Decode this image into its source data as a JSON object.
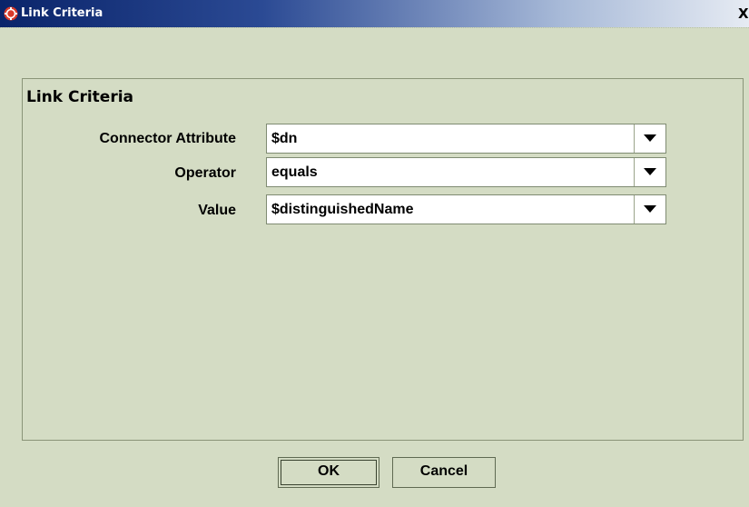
{
  "window": {
    "title": "Link Criteria",
    "close_label": "X",
    "icon": "app-logo-icon"
  },
  "panel": {
    "title": "Link Criteria",
    "fields": [
      {
        "label": "Connector Attribute",
        "value": "$dn",
        "icon": "chevron-down-icon"
      },
      {
        "label": "Operator",
        "value": "equals",
        "icon": "chevron-down-icon"
      },
      {
        "label": "Value",
        "value": "$distinguishedName",
        "icon": "chevron-down-icon"
      }
    ]
  },
  "buttons": {
    "ok_label": "OK",
    "cancel_label": "Cancel"
  },
  "colors": {
    "background": "#d4dcc4",
    "titlebar_start": "#0a246a",
    "titlebar_end": "#e6ebf3",
    "icon_red": "#d83a2a"
  }
}
